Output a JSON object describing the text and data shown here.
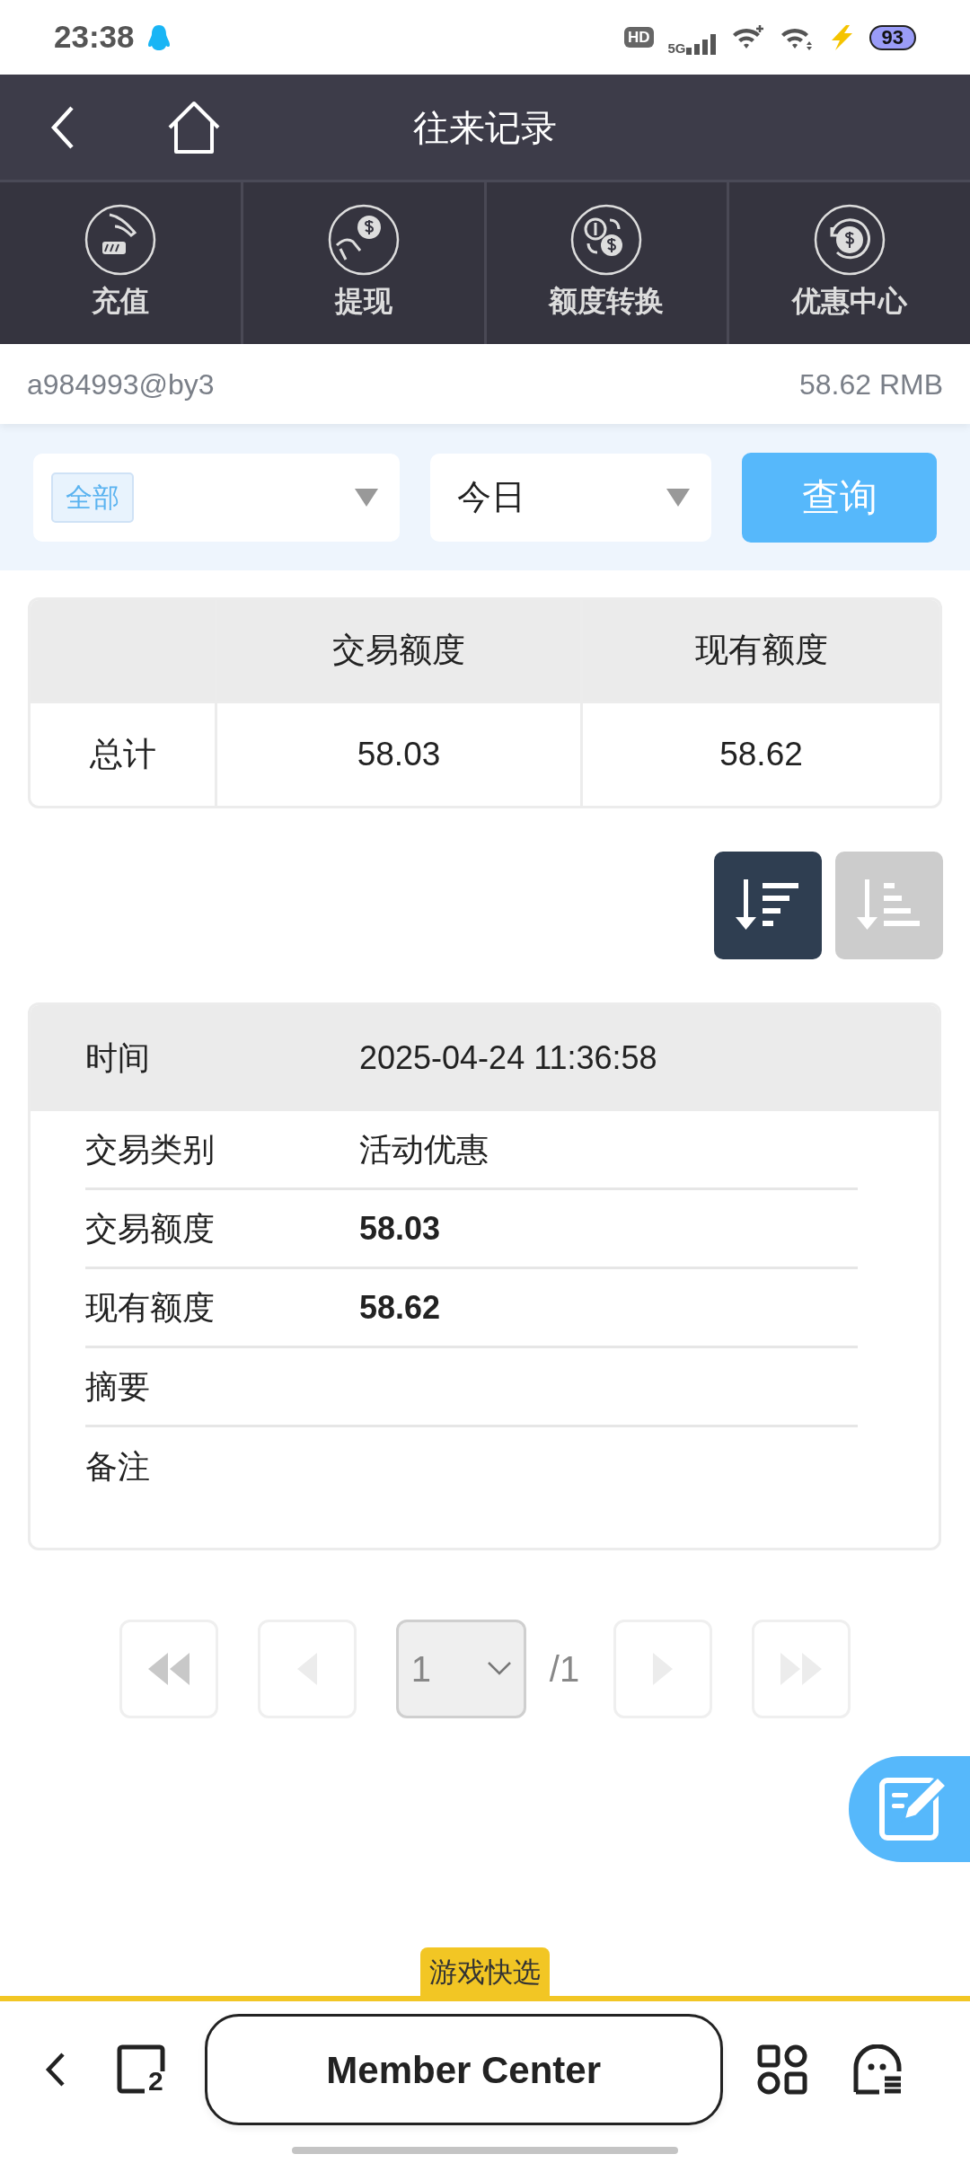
{
  "status_bar": {
    "time": "23:38",
    "hd": "HD",
    "network": "5G",
    "battery": "93"
  },
  "header": {
    "title": "往来记录"
  },
  "quick_actions": [
    {
      "kind": "deposit",
      "label": "充值"
    },
    {
      "kind": "withdraw",
      "label": "提现"
    },
    {
      "kind": "transfer",
      "label": "额度转换"
    },
    {
      "kind": "promotions",
      "label": "优惠中心"
    }
  ],
  "account": {
    "username": "a984993@by3",
    "balance": "58.62 RMB"
  },
  "filters": {
    "category": {
      "tag": "全部"
    },
    "period": {
      "value": "今日"
    },
    "query_button": "查询"
  },
  "summary_table": {
    "columns": [
      "交易额度",
      "现有额度"
    ],
    "rows": [
      {
        "label": "总计",
        "cells": [
          "58.03",
          "58.62"
        ]
      }
    ]
  },
  "sort_buttons": [
    {
      "kind": "descending",
      "selected": true
    },
    {
      "kind": "ascending",
      "selected": false
    }
  ],
  "record": {
    "header": {
      "label": "时间",
      "value": "2025-04-24 11:36:58"
    },
    "fields": [
      {
        "label": "交易类别",
        "value": "活动优惠",
        "emphasis": false
      },
      {
        "label": "交易额度",
        "value": "58.03",
        "emphasis": true
      },
      {
        "label": "现有额度",
        "value": "58.62",
        "emphasis": true
      },
      {
        "label": "摘要"
      },
      {
        "label": "备注"
      }
    ]
  },
  "pagination": {
    "page": "1",
    "total": "/1",
    "buttons": [
      {
        "kind": "first",
        "disabled": false
      },
      {
        "kind": "prev",
        "disabled": true
      },
      {
        "kind": "next",
        "disabled": true
      },
      {
        "kind": "last",
        "disabled": true
      }
    ]
  },
  "quick_pick_tab": "游戏快选",
  "browser_bar": {
    "tab_count": "2",
    "address": "Member Center"
  }
}
